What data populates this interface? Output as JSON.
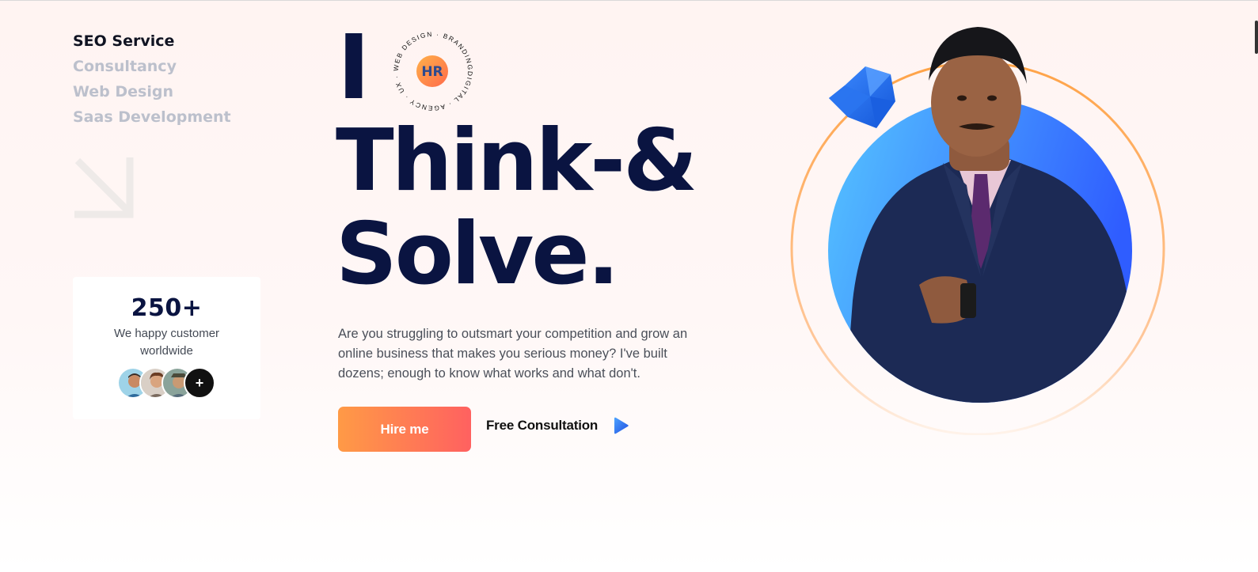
{
  "services": {
    "items": [
      {
        "label": "SEO Service",
        "active": true
      },
      {
        "label": "Consultancy",
        "active": false
      },
      {
        "label": "Web Design",
        "active": false
      },
      {
        "label": "Saas Development",
        "active": false
      }
    ]
  },
  "stats": {
    "number": "250+",
    "text": "We happy customer worldwide",
    "more_symbol": "+"
  },
  "badge": {
    "logo": "HR",
    "ring_text": "WEB DESIGN · BRANDINGDIGITAL · AGENCY · UX ·"
  },
  "hero": {
    "line0": "I",
    "line1": "Think-&",
    "line2": "Solve."
  },
  "description": "Are you struggling to outsmart your competition and grow an online business that makes you serious money? I've built dozens; enough to know what works and what don't.",
  "cta": {
    "hire_label": "Hire me",
    "consult_label": "Free Consultation"
  },
  "colors": {
    "navy": "#0a1441",
    "orange": "#ff9a46",
    "coral": "#ff6160",
    "blue": "#2f6bff",
    "muted": "#bcc0cc"
  },
  "icons": {
    "arrow": "arrow-down-right-icon",
    "play": "play-icon",
    "gem": "gem-icon"
  }
}
